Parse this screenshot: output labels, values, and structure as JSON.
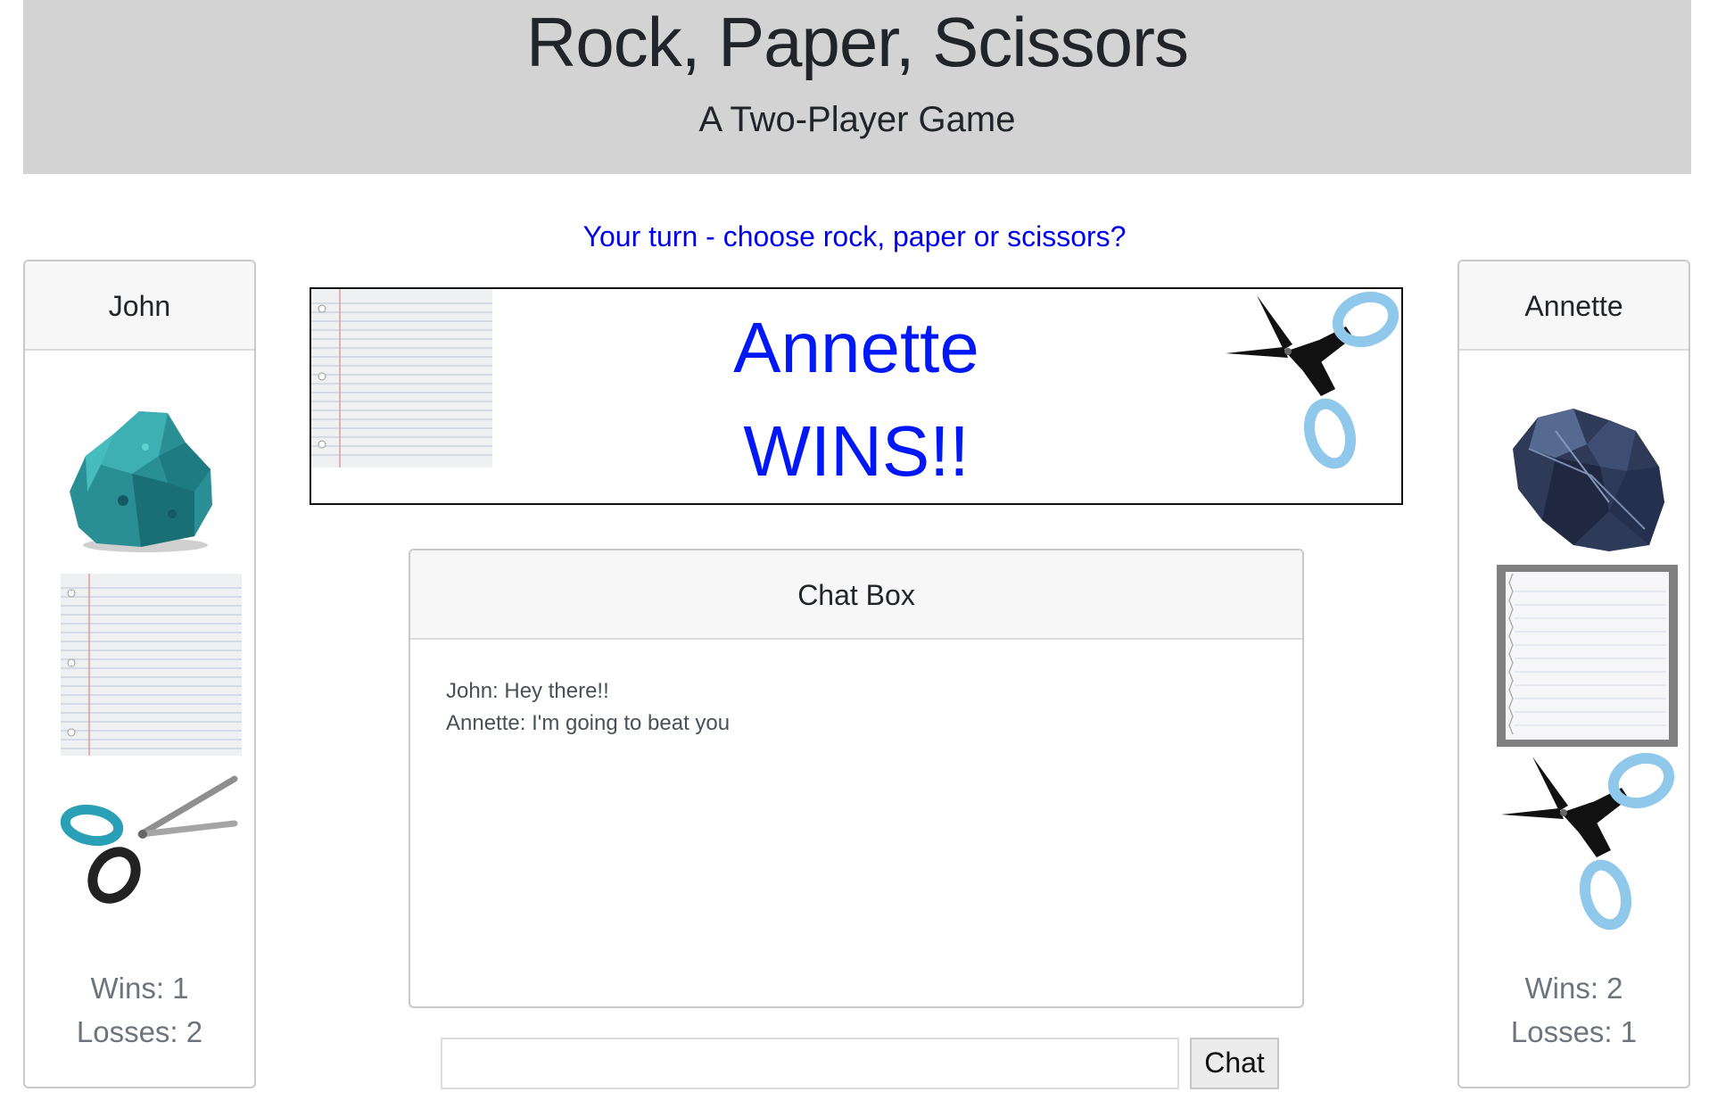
{
  "header": {
    "title": "Rock, Paper, Scissors",
    "subtitle": "A Two-Player Game"
  },
  "turn_message": "Your turn - choose rock, paper or scissors?",
  "players": [
    {
      "name": "John",
      "choices": [
        "rock-image",
        "paper-image",
        "scissors-image"
      ],
      "wins": "Wins: 1",
      "losses": "Losses: 2"
    },
    {
      "name": "Annette",
      "choices": [
        "rock-image",
        "paper-image",
        "scissors-image"
      ],
      "selected": "paper",
      "wins": "Wins: 2",
      "losses": "Losses: 1"
    }
  ],
  "result": {
    "line1": "Annette",
    "line2": "WINS!!",
    "left_choice": "paper-image",
    "right_choice": "scissors-image"
  },
  "chat": {
    "header": "Chat Box",
    "messages": [
      "John: Hey there!!",
      "Annette: I'm going to beat you"
    ],
    "input_value": "",
    "button_label": "Chat"
  },
  "colors": {
    "jumbotron_bg": "#d3d3d3",
    "accent_blue": "#0018f5",
    "turn_blue": "#0000ee"
  }
}
